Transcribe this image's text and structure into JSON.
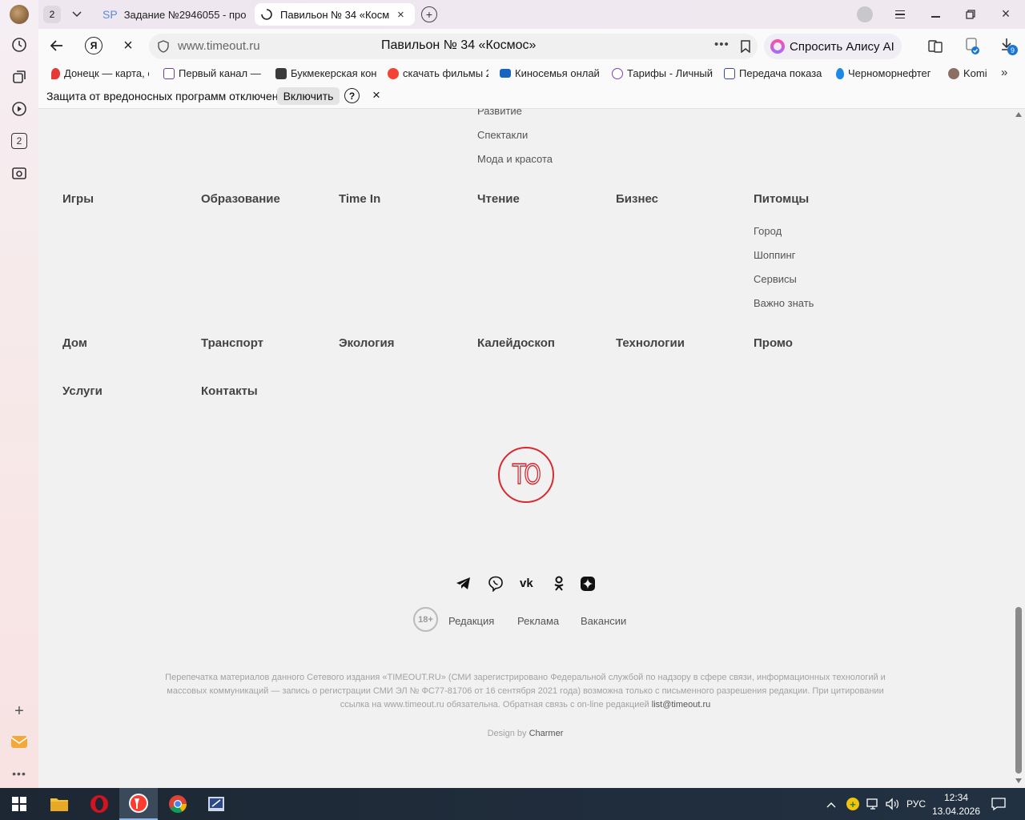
{
  "browser": {
    "tab_count": "2",
    "tabs": [
      {
        "prefix": "SP",
        "title": "Задание №2946055 - про"
      },
      {
        "title": "Павильон № 34 «Косм"
      }
    ],
    "address": {
      "domain": "www.timeout.ru",
      "page_title": "Павильон № 34 «Космос»"
    },
    "alice_label": "Спросить Алису AI",
    "downloads_badge": "9",
    "sidebar_badge": "2",
    "bookmarks": [
      {
        "label": "Донецк — карта, с",
        "color": "#e53935"
      },
      {
        "label": "Первый канал — с",
        "color": "#6b3fa0"
      },
      {
        "label": "Букмекерская кон",
        "color": "#3a3a3a"
      },
      {
        "label": "скачать фильмы 2",
        "color": "#f44336"
      },
      {
        "label": "Киносемья онлай",
        "color": "#1565c0"
      },
      {
        "label": "Тарифы - Личный",
        "color": "#7b3fbf"
      },
      {
        "label": "Передача показа",
        "color": "#3949ab"
      },
      {
        "label": "Черноморнефтег",
        "color": "#1e88e5"
      },
      {
        "label": "Komi",
        "color": "#8d6e63"
      }
    ],
    "infobar": {
      "message": "Защита от вредоносных программ отключена",
      "enable_label": "Включить",
      "help_glyph": "?",
      "close_glyph": "×"
    }
  },
  "page": {
    "top_links": [
      "Развитие",
      "Спектакли",
      "Мода и красота"
    ],
    "row1": [
      "Игры",
      "Образование",
      "Time In",
      "Чтение",
      "Бизнес",
      "Питомцы"
    ],
    "pets_links": [
      "Город",
      "Шоппинг",
      "Сервисы",
      "Важно знать"
    ],
    "row2": [
      "Дом",
      "Транспорт",
      "Экология",
      "Калейдоскоп",
      "Технологии",
      "Промо"
    ],
    "row3": [
      "Услуги",
      "Контакты"
    ],
    "logo_text": "TO",
    "age_badge": "18+",
    "footer_links": [
      "Редакция",
      "Реклама",
      "Вакансии"
    ],
    "legal_text": "Перепечатка материалов данного Сетевого издания «TIMEOUT.RU» (СМИ зарегистрировано Федеральной службой по надзору в сфере связи, информационных технологий и массовых коммуникаций — запись о регистрации СМИ ЭЛ № ФС77-81706 от 16 сентября 2021 года) возможна только с письменного разрешения редакции. При цитировании ссылка на www.timeout.ru обязательна. Обратная связь с on-line редакцией",
    "legal_email": "list@timeout.ru",
    "design_prefix": "Design by",
    "design_name": "Charmer",
    "brand_color": "#d9282f"
  },
  "taskbar": {
    "lang": "РУС",
    "time": "12:34",
    "date": "13.04.2026"
  }
}
